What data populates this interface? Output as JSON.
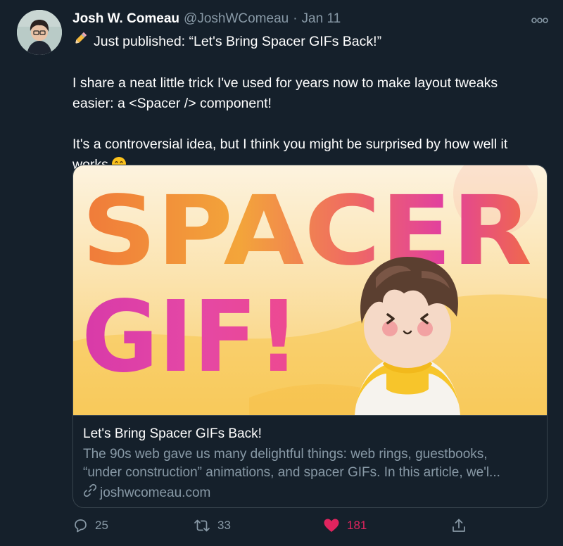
{
  "author": {
    "name": "Josh W. Comeau",
    "handle": "@JoshWComeau",
    "separator": "·",
    "date": "Jan 11"
  },
  "tweet": {
    "line1": "Just published: “Let's Bring Spacer GIFs Back!”",
    "line2": "I share a neat little trick I've used for years now to make layout tweaks",
    "line3": "easier: a <Spacer /> component!",
    "line4": "It's a controversial idea, but I think you might be surprised by how well it",
    "line5": "works"
  },
  "card": {
    "image_text_line1": "SPACER",
    "image_text_line2": "GIF!",
    "title": "Let's Bring Spacer GIFs Back!",
    "description_line1": "The 90s web gave us many delightful things: web rings, guestbooks,",
    "description_line2": "“under construction” animations, and spacer GIFs. In this article, we'l...",
    "domain": "joshwcomeau.com"
  },
  "actions": {
    "replies": "25",
    "retweets": "33",
    "likes": "181"
  },
  "icons": {
    "more": "more-icon",
    "pencil": "pencil-emoji",
    "smile": "grinning-emoji",
    "link": "link-icon",
    "reply": "reply-icon",
    "retweet": "retweet-icon",
    "like": "heart-icon",
    "share": "share-icon"
  },
  "colors": {
    "background": "#15202b",
    "secondary_text": "#8899a6",
    "border": "#38444d",
    "like": "#e0245e"
  }
}
